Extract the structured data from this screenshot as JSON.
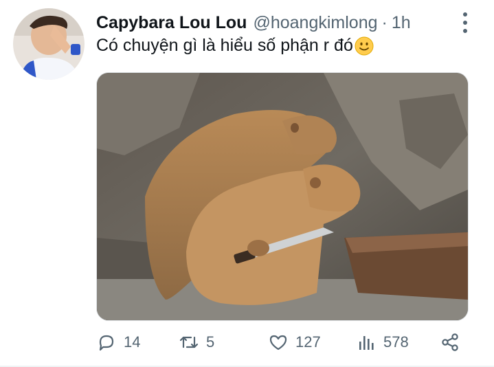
{
  "tweet": {
    "author_name": "Capybara Lou Lou",
    "handle": "@hoangkimlong",
    "separator": "·",
    "time": "1h",
    "text": "Có chuyện gì là hiểu số phận r đó",
    "emoji": "slightly-smiling-face-icon"
  },
  "actions": {
    "reply_count": "14",
    "retweet_count": "5",
    "like_count": "127",
    "views_count": "578"
  },
  "colors": {
    "text": "#0f1419",
    "secondary": "#536471",
    "divider": "#eff3f4"
  }
}
